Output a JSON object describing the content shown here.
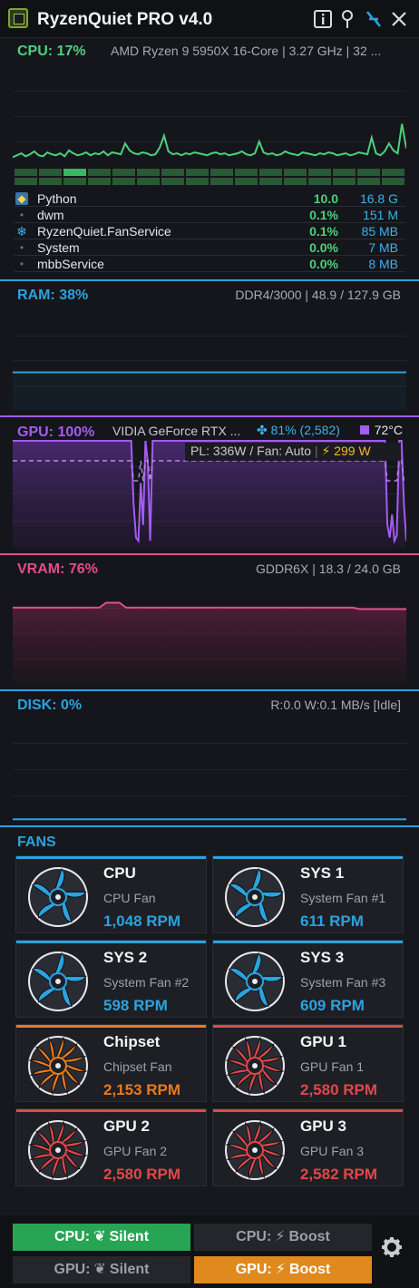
{
  "app": {
    "title": "RyzenQuiet PRO v4.0"
  },
  "cpu": {
    "title": "CPU: 17%",
    "info": "AMD Ryzen 9 5950X 16-Core | 3.27 GHz | 32 ...",
    "color": "#4cd17c",
    "load_history": [
      8,
      10,
      12,
      9,
      11,
      14,
      10,
      9,
      13,
      11,
      10,
      12,
      9,
      15,
      12,
      10,
      11,
      13,
      10,
      12,
      11,
      14,
      10,
      13,
      12,
      11,
      22,
      15,
      12,
      11,
      13,
      12,
      10,
      11,
      18,
      30,
      14,
      11,
      12,
      10,
      12,
      11,
      13,
      12,
      11,
      10,
      12,
      13,
      11,
      12,
      10,
      11,
      12,
      14,
      11,
      10,
      12,
      24,
      13,
      11,
      12,
      10,
      11,
      14,
      12,
      11,
      10,
      13,
      12,
      11,
      10,
      12,
      11,
      13,
      12,
      10,
      11,
      12,
      10,
      11,
      13,
      12,
      11,
      28,
      12,
      10,
      14,
      22,
      15,
      12,
      42,
      17
    ],
    "core_loads": [
      20,
      25,
      40,
      18,
      22,
      15,
      20,
      16,
      24,
      19,
      21,
      18,
      17,
      22,
      20,
      19
    ],
    "processes": [
      {
        "icon": "python-icon",
        "name": "Python",
        "cpu": "10.0",
        "mem": "16.8 G"
      },
      {
        "icon": "dot-icon",
        "name": "dwm",
        "cpu": "0.1%",
        "mem": "151 M"
      },
      {
        "icon": "snowflake-icon",
        "name": "RyzenQuiet.FanService",
        "cpu": "0.1%",
        "mem": "85 MB"
      },
      {
        "icon": "dot-icon",
        "name": "System",
        "cpu": "0.0%",
        "mem": "7 MB"
      },
      {
        "icon": "dot-icon",
        "name": "mbbService",
        "cpu": "0.0%",
        "mem": "8 MB"
      }
    ]
  },
  "ram": {
    "title": "RAM: 38%",
    "info": "DDR4/3000 | 48.9 / 127.9 GB",
    "color": "#2aa3de",
    "level": 0.38
  },
  "gpu": {
    "title": "GPU: 100%",
    "model": "VIDIA GeForce RTX ...",
    "fan": "81% (2,582)",
    "temp": "72°C",
    "limits": "PL: 336W / Fan: Auto",
    "power": "299 W",
    "color": "#a35cf0",
    "load_history": [
      100,
      100,
      100,
      100,
      100,
      100,
      100,
      100,
      100,
      100,
      100,
      100,
      100,
      100,
      100,
      100,
      100,
      100,
      100,
      100,
      100,
      100,
      100,
      100,
      100,
      100,
      100,
      100,
      100,
      100,
      100,
      100,
      100,
      100,
      100,
      100,
      100,
      100,
      100,
      100,
      100,
      100,
      100,
      100,
      100,
      100,
      100,
      100,
      100,
      100,
      100,
      40,
      8,
      5,
      60,
      20,
      100,
      80,
      5,
      100,
      100,
      100,
      100,
      100,
      100,
      100,
      100,
      100,
      100,
      100,
      100,
      100,
      100,
      100,
      100,
      100,
      100,
      100,
      100,
      100,
      100,
      100,
      100,
      100,
      100,
      100,
      100,
      100,
      100,
      100,
      100,
      100,
      100,
      100,
      100,
      100,
      100,
      100,
      100,
      100,
      100,
      100,
      100,
      100,
      100,
      100,
      100,
      100,
      100,
      100,
      100,
      100,
      100,
      100,
      100,
      100,
      100,
      100,
      100,
      100,
      100,
      100,
      100,
      100,
      100,
      100,
      100,
      100,
      100,
      100,
      100,
      100,
      100,
      100,
      100,
      100,
      100,
      100,
      100,
      100,
      100,
      100,
      100,
      100,
      100,
      100,
      100,
      100,
      100,
      100,
      100,
      100,
      100,
      100,
      100,
      100,
      100,
      100,
      20,
      8,
      30,
      5,
      10,
      100,
      100,
      40,
      5
    ]
  },
  "vram": {
    "title": "VRAM: 76%",
    "info": "GDDR6X | 18.3 / 24.0 GB",
    "color": "#e24c8e",
    "level": 0.76
  },
  "disk": {
    "title": "DISK: 0%",
    "info": "R:0.0 W:0.1 MB/s [Idle]",
    "color": "#2aa3de"
  },
  "fans": {
    "title": "FANS",
    "items": [
      {
        "name": "CPU",
        "sub": "CPU Fan",
        "rpm": "1,048 RPM",
        "color": "#2aa3de"
      },
      {
        "name": "SYS 1",
        "sub": "System Fan #1",
        "rpm": "611 RPM",
        "color": "#2aa3de"
      },
      {
        "name": "SYS 2",
        "sub": "System Fan #2",
        "rpm": "598 RPM",
        "color": "#2aa3de"
      },
      {
        "name": "SYS 3",
        "sub": "System Fan #3",
        "rpm": "609 RPM",
        "color": "#2aa3de"
      },
      {
        "name": "Chipset",
        "sub": "Chipset Fan",
        "rpm": "2,153 RPM",
        "color": "#ec7a1c"
      },
      {
        "name": "GPU 1",
        "sub": "GPU Fan 1",
        "rpm": "2,580 RPM",
        "color": "#e04848"
      },
      {
        "name": "GPU 2",
        "sub": "GPU Fan 2",
        "rpm": "2,580 RPM",
        "color": "#e04848"
      },
      {
        "name": "GPU 3",
        "sub": "GPU Fan 3",
        "rpm": "2,582 RPM",
        "color": "#e04848"
      }
    ]
  },
  "modes": {
    "cpu_label": "CPU:",
    "gpu_label": "GPU:",
    "silent": "Silent",
    "boost": "Boost"
  }
}
